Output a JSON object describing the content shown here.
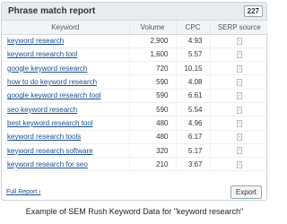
{
  "widget": {
    "title": "Phrase match report",
    "count": "227"
  },
  "table": {
    "columns": [
      "Keyword",
      "Volume",
      "CPC",
      "SERP source"
    ],
    "rows": [
      {
        "keyword": "keyword research",
        "volume": "2,900",
        "cpc": "4.93"
      },
      {
        "keyword": "keyword research tool",
        "volume": "1,600",
        "cpc": "5.57"
      },
      {
        "keyword": "google keyword research",
        "volume": "720",
        "cpc": "10.15"
      },
      {
        "keyword": "how to do keyword research",
        "volume": "590",
        "cpc": "4.08"
      },
      {
        "keyword": "google keyword research tool",
        "volume": "590",
        "cpc": "6.61"
      },
      {
        "keyword": "seo keyword research",
        "volume": "590",
        "cpc": "5.54"
      },
      {
        "keyword": "best keyword research tool",
        "volume": "480",
        "cpc": "4.96"
      },
      {
        "keyword": "keyword research tools",
        "volume": "480",
        "cpc": "6.17"
      },
      {
        "keyword": "keyword research software",
        "volume": "320",
        "cpc": "5.17"
      },
      {
        "keyword": "keyword research for seo",
        "volume": "210",
        "cpc": "3.67"
      }
    ],
    "serp_icon": "document-icon"
  },
  "footer": {
    "full_report": "Full Report ›",
    "export": "Export"
  },
  "caption": "Example of SEM Rush Keyword Data for \"keyword research\""
}
